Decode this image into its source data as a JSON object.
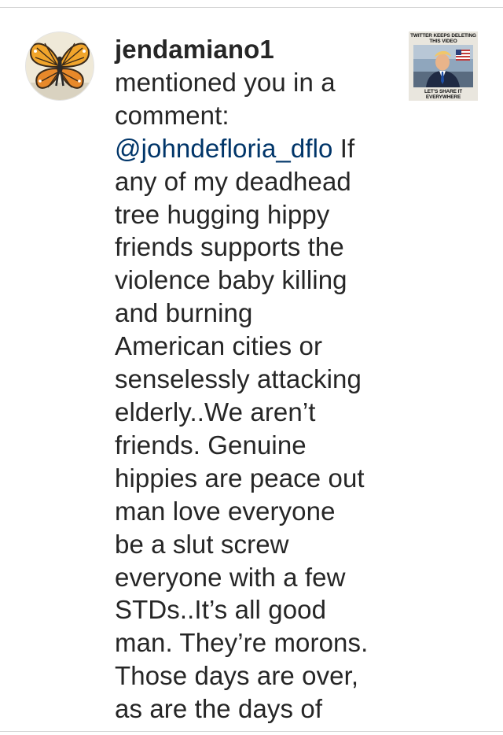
{
  "notification": {
    "username": "jendamiano1",
    "action": "mentioned you in a",
    "action_cont": "comment:",
    "mention": "@johndefloria_dflo",
    "lines": [
      "If",
      "any of my deadhead",
      "tree hugging hippy",
      "friends supports the",
      "violence baby killing",
      "and burning",
      "American cities or",
      "senselessly attacking",
      "elderly..We aren’t",
      "friends. Genuine",
      "hippies are peace out",
      "man love everyone",
      "be a slut screw",
      "everyone with a few",
      "STDs..It’s all good",
      "man. They’re morons.",
      "Those days are over,",
      "as are the days of"
    ]
  },
  "thumbnail": {
    "caption_top_1": "TWITTER KEEPS DELETING",
    "caption_top_2": "THIS VIDEO",
    "caption_bottom_1": "LET'S SHARE IT",
    "caption_bottom_2": "EVERYWHERE"
  },
  "colors": {
    "text": "#262626",
    "mention": "#003569",
    "divider": "#d6d6d6"
  },
  "icons": {
    "avatar": "butterfly-mural-avatar",
    "thumbnail": "video-post-thumbnail"
  }
}
